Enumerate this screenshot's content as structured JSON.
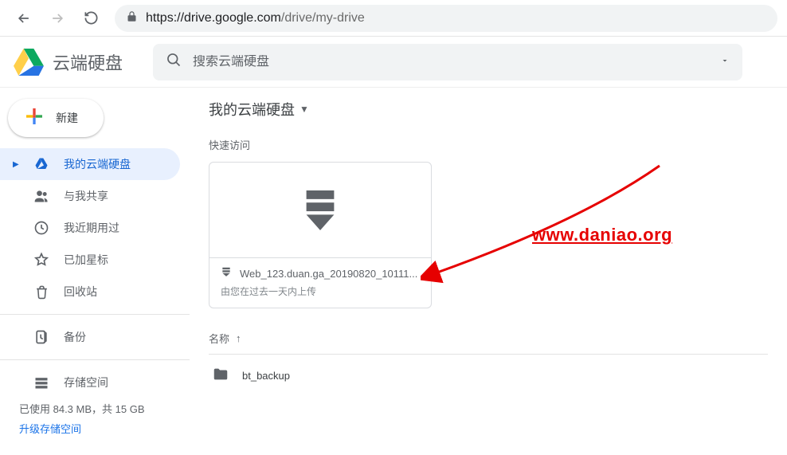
{
  "browser": {
    "host": "https://drive.google.com",
    "path": "/drive/my-drive"
  },
  "product_name": "云端硬盘",
  "search": {
    "placeholder": "搜索云端硬盘"
  },
  "new_button_label": "新建",
  "sidebar": {
    "items": [
      {
        "label": "我的云端硬盘"
      },
      {
        "label": "与我共享"
      },
      {
        "label": "我近期用过"
      },
      {
        "label": "已加星标"
      },
      {
        "label": "回收站"
      },
      {
        "label": "备份"
      },
      {
        "label": "存储空间"
      }
    ],
    "storage_used": "已使用 84.3 MB，共 15 GB",
    "upgrade_label": "升级存储空间"
  },
  "main": {
    "breadcrumb": "我的云端硬盘",
    "quick_access_label": "快速访问",
    "card": {
      "title": "Web_123.duan.ga_20190820_10111...",
      "subtitle": "由您在过去一天内上传"
    },
    "name_header": "名称",
    "folder_name": "bt_backup"
  },
  "watermark": "www.daniao.org"
}
